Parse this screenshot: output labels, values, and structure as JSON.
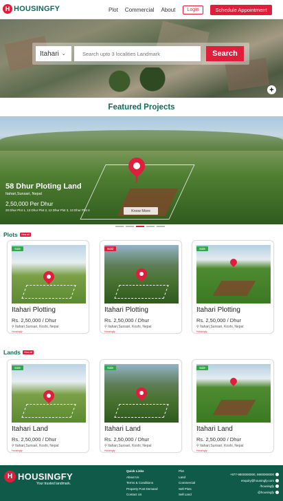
{
  "brand": {
    "logo_letter": "H",
    "name": "HOUSINGFY",
    "tagline": "Your trusted landmark."
  },
  "nav": {
    "links": [
      "Plot",
      "Commercial",
      "About"
    ],
    "login": "Login",
    "schedule": "Schedule Appointment"
  },
  "search": {
    "city": "Itahari",
    "placeholder": "Search upto 3 localities Landmark",
    "button": "Search",
    "plus": "+"
  },
  "featured": {
    "heading": "Featured Projects",
    "name": "58 Dhur Ploting Land",
    "location": "Itahari,Sunsari, Nepal",
    "price": "2,50,000 Per Dhur",
    "subplots": "20 Dhur Plot 1, 13 Dhur Plot 2, 12 Dhur Plot 3, 13 Dhur Plot 4",
    "know_more": "Know More",
    "slides_total": 5,
    "slide_active": 3
  },
  "plots": {
    "title": "Plots",
    "view_all": "View all",
    "items": [
      {
        "badge": "Sale",
        "title": "Itahari Plotting",
        "price": "Rs. 2,50,000 / Dhur",
        "location": "Itahari,Sunsari, Koshi, Nepal",
        "brand": "Housingfy"
      },
      {
        "badge": "Sold",
        "title": "Itahari Plotting",
        "price": "Rs. 2,50,000 / Dhur",
        "location": "Itahari,Sunsari, Koshi, Nepal",
        "brand": "Housingfy"
      },
      {
        "badge": "Sale",
        "title": "Itahari Plotting",
        "price": "Rs. 2,50,000 / Dhur",
        "location": "Itahari,Sunsari, Koshi, Nepal",
        "brand": "Housingfy"
      }
    ]
  },
  "lands": {
    "title": "Lands",
    "view_all": "View all",
    "items": [
      {
        "badge": "Sale",
        "title": "Itahari Land",
        "price": "Rs. 2,50,000 / Dhur",
        "location": "Itahari,Sunsari, Koshi, Nepal",
        "brand": "Housingfy"
      },
      {
        "badge": "Sale",
        "title": "Itahari Land",
        "price": "Rs. 2,50,000 / Dhur",
        "location": "Itahari,Sunsari, Koshi, Nepal",
        "brand": "Housingfy"
      },
      {
        "badge": "Sale",
        "title": "Itahari Land",
        "price": "Rs. 2,50,000 / Dhur",
        "location": "Itahari,Sunsari, Koshi, Nepal",
        "brand": "Housingfy"
      }
    ]
  },
  "footer": {
    "quick_links_title": "Quick Links",
    "quick_links": [
      "About Us",
      "Terms & Conditions",
      "Property Post Demand",
      "Contact Us"
    ],
    "plot_col": [
      "Plot",
      "Land",
      "Commercial",
      "Sell Plots",
      "Sell Land"
    ],
    "contact": [
      "+977-9800000000, 9800000000",
      "enquiry@housingfy.com",
      "/housingfy",
      "@housingfy"
    ]
  },
  "colors": {
    "brand_green": "#0f6b57",
    "accent_red": "#e01e3c",
    "sale_green": "#2ea84a",
    "footer_bg": "#0f5a48"
  }
}
